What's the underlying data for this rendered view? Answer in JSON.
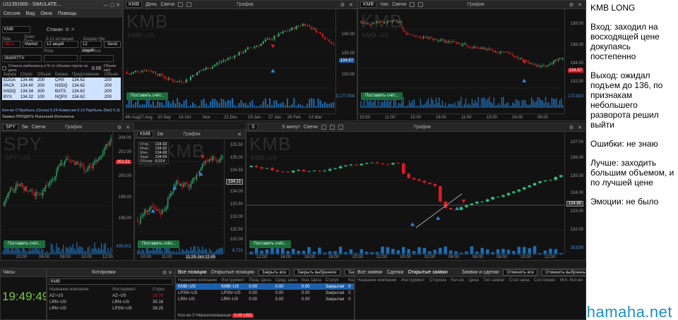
{
  "status": {
    "text": "U11391900 - SIMULATE..."
  },
  "menu": [
    "Сессия",
    "Вид",
    "Окна",
    "Помощь"
  ],
  "order": {
    "symbol": "KMB",
    "title": "Стакан",
    "labels": {
      "side": "Side",
      "order_type": "Order Type",
      "quantity": "0.12 шт/акций",
      "display": "Display Qty"
    },
    "side": "SELL",
    "order_type": "Market",
    "quantity": "12 акций",
    "display_qty": "12 акций",
    "send": "Send",
    "route": "SMARTTV",
    "price_lbl": "Price",
    "stop_lbl": "Stop Price",
    "imbalance_text": "Отмена имбаланса к % от объема торгов за день",
    "imbalance_value": "0.00",
    "volume_label": "Объем имб"
  },
  "depth": {
    "headers": [
      "Биржа",
      "Спрос",
      "Объем",
      "Биржа",
      "Предложение",
      "Объем"
    ],
    "rows": [
      [
        "EDGA",
        "134.46",
        "200",
        "CHX",
        "134.62",
        "200"
      ],
      [
        "PACK",
        "134.40",
        "200",
        "NSDQ",
        "134.62",
        "200"
      ],
      [
        "NSDQ",
        "134.34",
        "300",
        "BATS",
        "134.62",
        "200"
      ],
      [
        "BYX",
        "134.32",
        "100",
        "NQPX",
        "134.62",
        "200"
      ]
    ],
    "footer": "Кол-во 0   Прибыль (Gross) 5.24   Комиссия 0.13   Прибыль (Net) 5.11",
    "footer2": "Заявка ПРОДАТЬ Рыночной Исполнена"
  },
  "charts": {
    "day": {
      "symbol": "KMB",
      "interval": "День",
      "type": "Свечи",
      "center": "График",
      "big": "KMB",
      "sub": "KMB~US",
      "yticks": [
        "140.00",
        "135.00",
        "130.00"
      ],
      "price": "134.57",
      "xticks": [
        "4th Aug",
        "27 Aug",
        "20 Sep",
        "16 Oct",
        "Nov",
        "22 Dec",
        "19 Jan",
        "27 Jan",
        "26 Feb",
        "13 Mar"
      ],
      "vol": "3,177,504",
      "place": "Поставить счёт..."
    },
    "hour": {
      "symbol": "KMB",
      "interval": "Час",
      "type": "Свечи",
      "center": "График",
      "big": "KMB",
      "sub": "KMB~US",
      "yticks": [
        "138.00",
        "136.00",
        "134.00",
        "132.00"
      ],
      "price": "134.57",
      "xticks": [
        "15:00",
        "11:00",
        "15:00",
        "16:00",
        "11:00",
        "15:00",
        "16:00",
        "09:00"
      ],
      "vol": "172,820",
      "place": "Поставить счёт..."
    },
    "spy": {
      "symbol": "SPY",
      "interval": "5м",
      "type": "Свечи",
      "center": "График",
      "big": "SPY",
      "sub": "SPY~US",
      "yticks": [
        "204.00",
        "202.00",
        "200.00",
        "198.00",
        "196.00"
      ],
      "price": "201.51",
      "xticks": [
        "20:00",
        "06:00",
        "08:00",
        "10:00",
        "12:00"
      ],
      "vol": "435,001",
      "place": "Поставить счёт..."
    },
    "kmb1": {
      "symbol": "KMB",
      "interval": "1м",
      "type": "Свечи",
      "center": "График",
      "big": "KMB",
      "sub": "KMB~US",
      "ohlc": [
        [
          "Откр.",
          "134.92"
        ],
        [
          "Макс.",
          "134.92"
        ],
        [
          "Мин.",
          "134.68"
        ],
        [
          "Закр.",
          "134.69"
        ],
        [
          "Объем",
          "6,014"
        ]
      ],
      "yticks": [
        "135.50",
        "135.00",
        "134.50",
        "134.00",
        "133.50",
        "133.00",
        "132.50",
        "132.00"
      ],
      "price": "134.11",
      "xticks": [
        "10:00",
        "11:00",
        "11:26 Jan 11:45"
      ],
      "vol": "8,721",
      "place": "Поставить счёт..."
    },
    "kmb5": {
      "symbol": "S",
      "interval": "5 минут",
      "type": "Свечи",
      "center": "График",
      "big": "KMB",
      "sub": "KMB~US",
      "yticks": [
        "137.00",
        "136.00",
        "135.00",
        "134.00",
        "133.00",
        "132.00"
      ],
      "price": "134.88",
      "xticks": [
        "12:00",
        "14:00",
        "16:00",
        "18:00",
        "20:00",
        "22:00",
        "00:00",
        "02:00",
        "04:00",
        "06:00",
        "08:00",
        "10:00",
        "12:00"
      ],
      "vol": "28,839",
      "place": "Поставить счёт..."
    }
  },
  "clock": {
    "title": "Часы",
    "time": "19:49:49"
  },
  "quotes": {
    "title": "Котировки",
    "symbol": "KMB",
    "headers": [
      "Название компании",
      "Инструмент",
      "Спрос"
    ],
    "rows": [
      [
        "AZ~US",
        "AZ~US",
        "28.79"
      ],
      [
        "LRN~US",
        "LRN~US",
        "35.16"
      ],
      [
        "LRN~US",
        "LPSN~US",
        "28.25"
      ]
    ]
  },
  "positions": {
    "tabs": [
      "Все позиции",
      "Открытые позиции"
    ],
    "buttons": [
      "Закрыть все",
      "Закрыть выбранное",
      "Закрыть длинные"
    ],
    "headers": [
      "Название компании",
      "Инструмент",
      "Поза. Цена",
      "Сред. цена",
      "Кон. Цена",
      "Статус",
      "Кол-во"
    ],
    "rows": [
      [
        "KMB~US",
        "KMB~US",
        "0.00",
        "0.00",
        "0.00",
        "Закрытая",
        "0"
      ],
      [
        "LPSN~US",
        "LPSN~US",
        "0.00",
        "0.00",
        "0.00",
        "Закрытая",
        "0"
      ],
      [
        "LRN~US",
        "LRN~US",
        "0.00",
        "0.00",
        "0.00",
        "Закрытая",
        "0"
      ]
    ],
    "footer": "Кол-во 0    Нереализованная",
    "footer_value": "0.00 USD"
  },
  "orders": {
    "tabs": [
      "Все заявки",
      "Сделки",
      "Открытые заявки"
    ],
    "title": "Заявки и сделки",
    "buttons": [
      "Отменить все",
      "Отменить выбранные"
    ],
    "headers": [
      "Название компании",
      "Инструмент",
      "Сторона",
      "Кол-во",
      "Цена",
      "Тип заявки",
      "Стоп цена",
      "Состояние",
      "Исп. Кол-во"
    ]
  },
  "notes": [
    "KMB LONG",
    "Вход: заходил на восходящей цене докупаясь постепенно",
    "Выход: ожидал подъем до 136, по признакам небольшего разворота решил выйти",
    "Ошибки: не знаю",
    "Лучше: заходить большим объемом, и по лучшей цене",
    "Эмоции: не было"
  ],
  "watermark": "hamaha.net",
  "colors": {
    "up": "#2ec27e",
    "down": "#e01b24",
    "accent": "#1e5fa8",
    "green_btn": "#1b6b3a",
    "clock": "#7ac943"
  }
}
